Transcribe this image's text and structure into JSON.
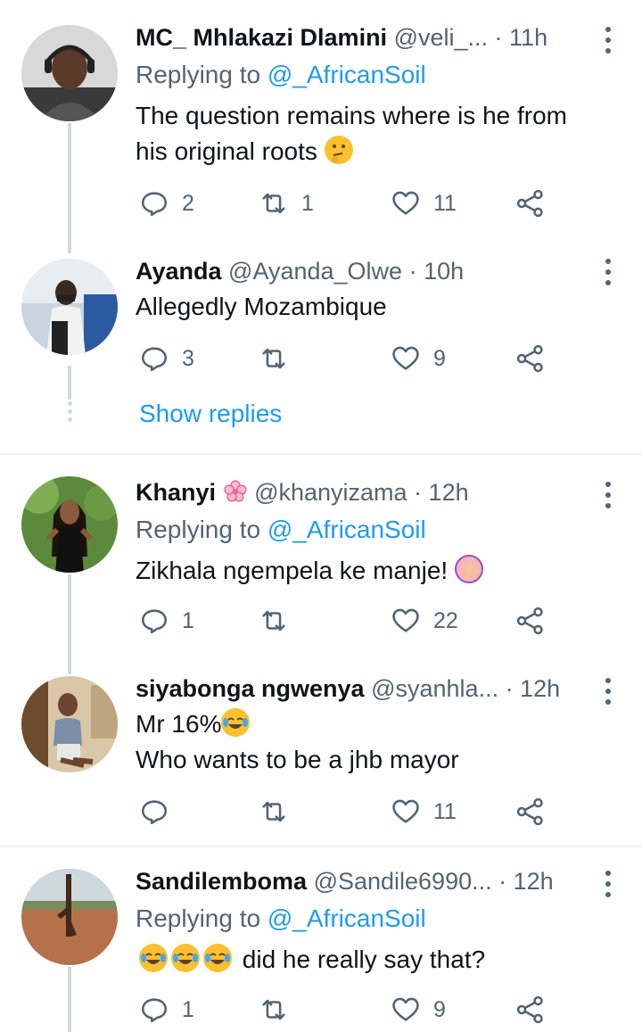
{
  "tweets": [
    {
      "name": "MC_ Mhlakazi Dlamini",
      "handle": "@veli_...",
      "dot": " · ",
      "time": "11h",
      "replying_prefix": "Replying to ",
      "replying_to": "@_AfricanSoil",
      "text_line1": "The question remains where is he from",
      "text_line2": "his original roots",
      "emoji": "thinking-face",
      "replies": "2",
      "retweets": "1",
      "likes": "11"
    },
    {
      "name": "Ayanda",
      "handle": "@Ayanda_Olwe",
      "dot": " · ",
      "time": "10h",
      "text_line1": "Allegedly Mozambique",
      "replies": "3",
      "retweets": "",
      "likes": "9",
      "show_replies": "Show replies"
    },
    {
      "name": "Khanyi",
      "name_emoji": "cherry-blossom",
      "handle": "@khanyizama",
      "dot": " · ",
      "time": "12h",
      "replying_prefix": "Replying to ",
      "replying_to": "@_AfricanSoil",
      "text_line1": "Zikhala ngempela ke manje!",
      "emoji": "person-gesturing-no",
      "replies": "1",
      "retweets": "",
      "likes": "22"
    },
    {
      "name": "siyabonga ngwenya",
      "handle": "@syanhla...",
      "dot": " · ",
      "time": "12h",
      "text_line1": "Mr 16%",
      "emoji": "face-with-tears-of-joy",
      "text_line2": "Who wants to be a jhb mayor",
      "replies": "",
      "retweets": "",
      "likes": "11"
    },
    {
      "name": "Sandilemboma",
      "handle": "@Sandile6990...",
      "dot": " · ",
      "time": "12h",
      "replying_prefix": "Replying to ",
      "replying_to": "@_AfricanSoil",
      "emoji": "face-with-tears-of-joy",
      "emoji_count": 3,
      "text_line1": " did he really say that?",
      "replies": "1",
      "retweets": "",
      "likes": "9"
    }
  ],
  "colors": {
    "link": "#1d9bf0",
    "secondary_text": "#536471",
    "thread_line": "#cfd9de",
    "divider": "#eff3f4"
  }
}
